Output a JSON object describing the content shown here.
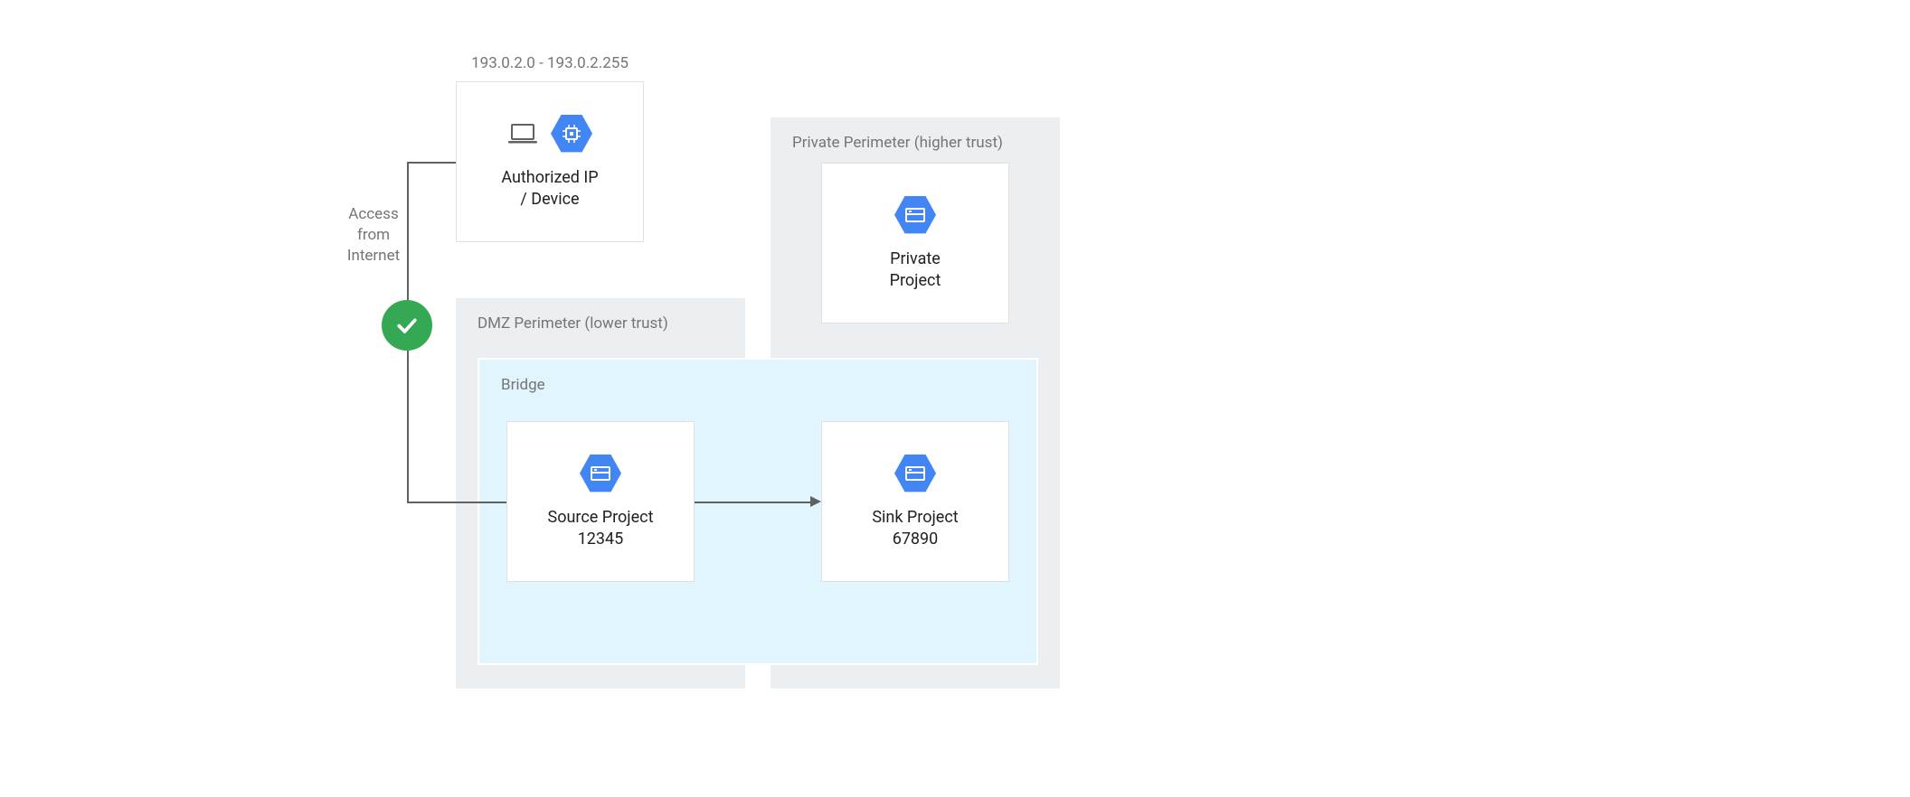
{
  "ip_range": "193.0.2.0 - 193.0.2.255",
  "auth_device": {
    "label": "Authorized IP\n/ Device"
  },
  "access_label": "Access\nfrom\nInternet",
  "dmz": {
    "title": "DMZ Perimeter (lower trust)"
  },
  "private": {
    "title": "Private Perimeter (higher trust)"
  },
  "bridge": {
    "title": "Bridge"
  },
  "source": {
    "label": "Source Project\n12345"
  },
  "sink": {
    "label": "Sink Project\n67890"
  },
  "private_project": {
    "label": "Private\nProject"
  },
  "colors": {
    "accent": "#4285F4",
    "success": "#34A853",
    "muted": "#757575"
  }
}
